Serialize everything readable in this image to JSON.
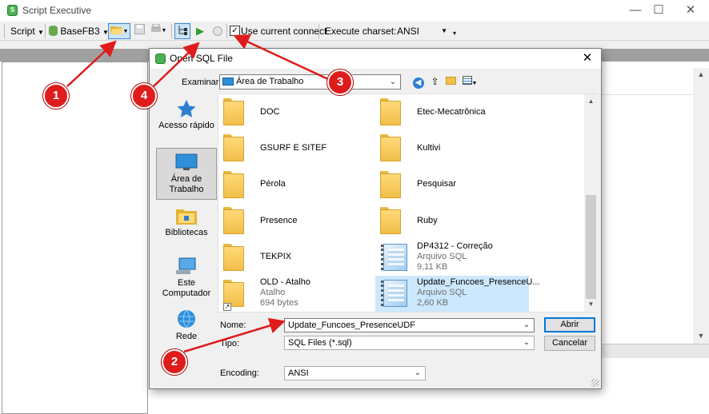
{
  "main_window": {
    "title": "Script Executive",
    "controls": {
      "minimize": "—",
      "maximize": "☐",
      "close": "✕"
    }
  },
  "toolbar": {
    "script_menu": "Script",
    "database_menu": "BaseFB3",
    "use_current_connect_label": "Use current connect",
    "use_current_connect_checked": true,
    "execute_charset_label": "Execute charset:",
    "execute_charset_value": "ANSI"
  },
  "dialog": {
    "title": "Open SQL File",
    "look_in_label": "Examinar:",
    "look_in_value": "Área de Trabalho",
    "places": [
      {
        "label": "Acesso rápido",
        "icon": "star-icon"
      },
      {
        "label": "Área de Trabalho",
        "icon": "desktop-icon",
        "selected": true
      },
      {
        "label": "Bibliotecas",
        "icon": "library-icon"
      },
      {
        "label": "Este Computador",
        "icon": "computer-icon"
      },
      {
        "label": "Rede",
        "icon": "network-icon"
      }
    ],
    "files": [
      {
        "name": "DOC",
        "type": "folder"
      },
      {
        "name": "Etec-Mecatrônica",
        "type": "folder"
      },
      {
        "name": "GSURF E SITEF",
        "type": "folder"
      },
      {
        "name": "Kultivi",
        "type": "folder"
      },
      {
        "name": "Pérola",
        "type": "folder"
      },
      {
        "name": "Pesquisar",
        "type": "folder"
      },
      {
        "name": "Presence",
        "type": "folder"
      },
      {
        "name": "Ruby",
        "type": "folder"
      },
      {
        "name": "TEKPIX",
        "type": "folder"
      },
      {
        "name": "DP4312 - Correção",
        "type": "sql",
        "subtitle": "Arquivo SQL",
        "size": "9,11 KB"
      },
      {
        "name": "OLD - Atalho",
        "type": "shortcut",
        "subtitle": "Atalho",
        "size": "694 bytes"
      },
      {
        "name": "Update_Funcoes_PresenceU...",
        "type": "sql",
        "subtitle": "Arquivo SQL",
        "size": "2,60 KB",
        "selected": true
      }
    ],
    "file_name_label": "Nome:",
    "file_name_value": "Update_Funcoes_PresenceUDF",
    "file_type_label": "Tipo:",
    "file_type_value": "SQL Files (*.sql)",
    "encoding_label": "Encoding:",
    "encoding_value": "ANSI",
    "open_button": "Abrir",
    "cancel_button": "Cancelar"
  },
  "annotations": {
    "markers": [
      "1",
      "2",
      "3",
      "4"
    ],
    "color": "#e01b1b"
  },
  "colors": {
    "selection": "#cce8ff",
    "accent": "#0078d7",
    "folder": "#f1bf4a"
  }
}
